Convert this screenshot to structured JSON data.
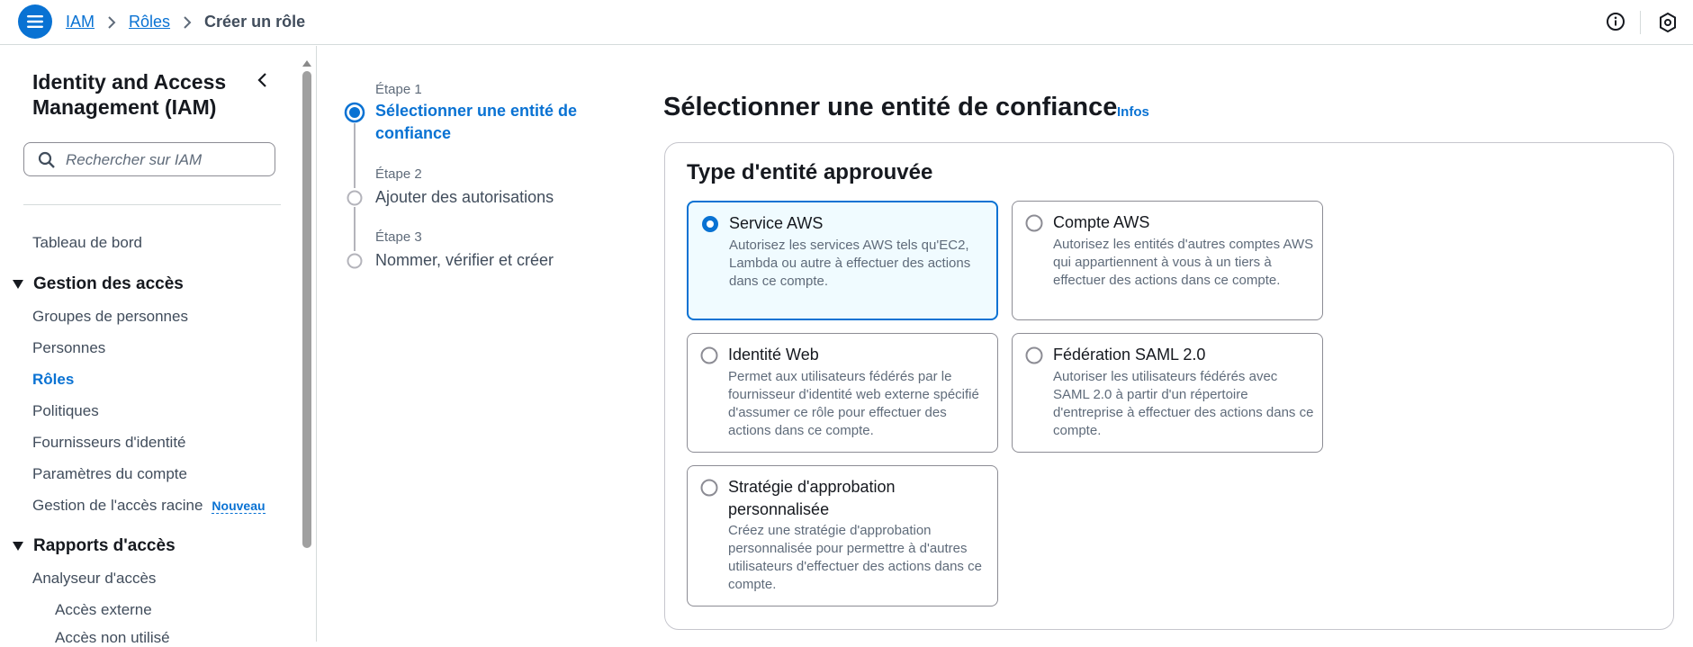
{
  "breadcrumb": {
    "items": [
      "IAM",
      "Rôles"
    ],
    "current": "Créer un rôle"
  },
  "icons": {
    "menu": "hamburger-menu-icon",
    "info": "info-circle-icon",
    "settings": "hexagon-settings-icon",
    "search": "search-icon"
  },
  "sidebar": {
    "title": "Identity and Access Management (IAM)",
    "search_placeholder": "Rechercher sur IAM",
    "dashboard": "Tableau de bord",
    "section_access": "Gestion des accès",
    "access_items": [
      "Groupes de personnes",
      "Personnes",
      "Rôles",
      "Politiques",
      "Fournisseurs d'identité",
      "Paramètres du compte",
      "Gestion de l'accès racine"
    ],
    "new_badge": "Nouveau",
    "section_reports": "Rapports d'accès",
    "reports_items": [
      "Analyseur d'accès",
      "Accès externe",
      "Accès non utilisé"
    ]
  },
  "steps": [
    {
      "label": "Étape 1",
      "title": "Sélectionner une entité de confiance"
    },
    {
      "label": "Étape 2",
      "title": "Ajouter des autorisations"
    },
    {
      "label": "Étape 3",
      "title": "Nommer, vérifier et créer"
    }
  ],
  "main": {
    "title": "Sélectionner une entité de confiance",
    "info": "Infos",
    "section_title": "Type d'entité approuvée",
    "selected": "Service AWS",
    "options": [
      {
        "title": "Service AWS",
        "desc": "Autorisez les services AWS tels qu'EC2, Lambda ou autre à effectuer des actions dans ce compte."
      },
      {
        "title": "Compte AWS",
        "desc": "Autorisez les entités d'autres comptes AWS qui appartiennent à vous à un tiers à effectuer des actions dans ce compte."
      },
      {
        "title": "Identité Web",
        "desc": "Permet aux utilisateurs fédérés par le fournisseur d'identité web externe spécifié d'assumer ce rôle pour effectuer des actions dans ce compte."
      },
      {
        "title": "Fédération SAML 2.0",
        "desc": "Autoriser les utilisateurs fédérés avec SAML 2.0 à partir d'un répertoire d'entreprise à effectuer des actions dans ce compte."
      },
      {
        "title": "Stratégie d'approbation personnalisée",
        "desc": "Créez une stratégie d'approbation personnalisée pour permettre à d'autres utilisateurs d'effectuer des actions dans ce compte."
      }
    ]
  },
  "colors": {
    "accent": "#0972d3",
    "selected_bg": "#f0fbff",
    "text": "#16191f",
    "muted": "#5f6b7a"
  }
}
